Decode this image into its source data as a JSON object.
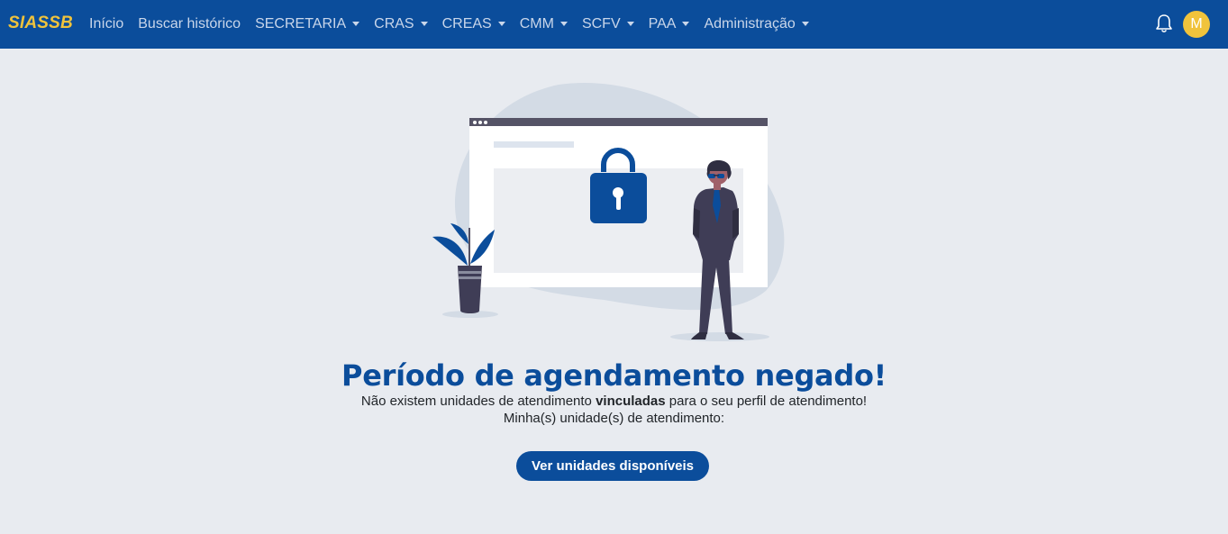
{
  "navbar": {
    "brand": "SIASSB",
    "items": [
      {
        "label": "Início",
        "dropdown": false
      },
      {
        "label": "Buscar histórico",
        "dropdown": false
      },
      {
        "label": "SECRETARIA",
        "dropdown": true
      },
      {
        "label": "CRAS",
        "dropdown": true
      },
      {
        "label": "CREAS",
        "dropdown": true
      },
      {
        "label": "CMM",
        "dropdown": true
      },
      {
        "label": "SCFV",
        "dropdown": true
      },
      {
        "label": "PAA",
        "dropdown": true
      },
      {
        "label": "Administração",
        "dropdown": true
      }
    ],
    "notifications_icon": "bell-icon",
    "avatar_initial": "M"
  },
  "main": {
    "title": "Período de agendamento negado!",
    "message_before": "Não existem unidades de atendimento ",
    "message_bold": "vinculadas",
    "message_after": " para o seu perfil de atendimento!",
    "units_label": "Minha(s) unidade(s) de atendimento:",
    "button_label": "Ver unidades disponíveis"
  },
  "colors": {
    "primary": "#0b4d9b",
    "brand_yellow": "#f0c33c",
    "background": "#e8ebf0"
  }
}
